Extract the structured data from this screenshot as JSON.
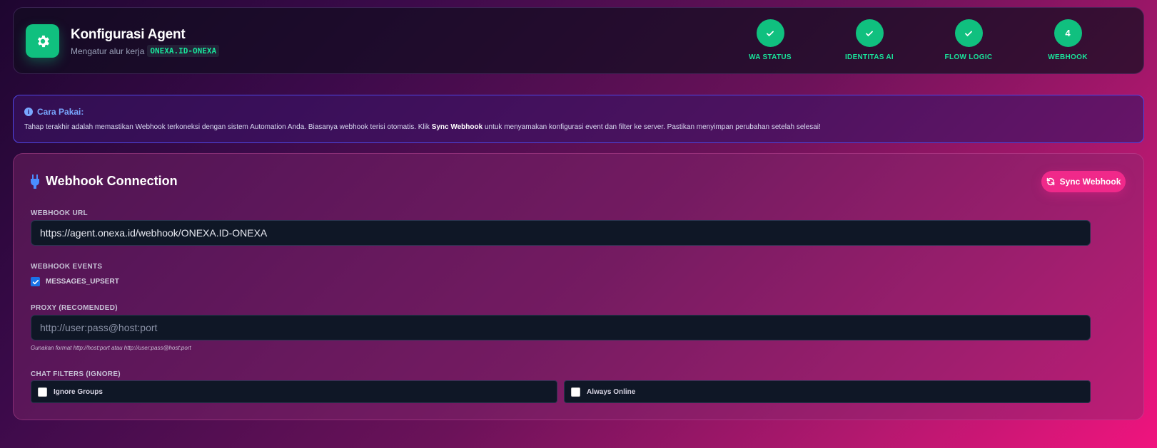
{
  "header": {
    "title": "Konfigurasi Agent",
    "subtitle_prefix": "Mengatur alur kerja",
    "instance_code": "ONEXA.ID-ONEXA",
    "logo_icon": "gear-icon",
    "accent_color": "#10c07f"
  },
  "steps": [
    {
      "label": "WA STATUS",
      "state": "done",
      "icon": "check-icon"
    },
    {
      "label": "IDENTITAS AI",
      "state": "done",
      "icon": "check-icon"
    },
    {
      "label": "FLOW LOGIC",
      "state": "done",
      "icon": "check-icon"
    },
    {
      "label": "WEBHOOK",
      "state": "current",
      "number": "4"
    }
  ],
  "info": {
    "title": "Cara Pakai:",
    "text_before": "Tahap terakhir adalah memastikan Webhook terkoneksi dengan sistem Automation Anda. Biasanya webhook terisi otomatis. Klik ",
    "text_bold": "Sync Webhook",
    "text_after": " untuk menyamakan konfigurasi event dan filter ke server. Pastikan menyimpan perubahan setelah selesai!",
    "border_color": "#4f46e5"
  },
  "webhook": {
    "section_title": "Webhook Connection",
    "section_icon": "plug-icon",
    "sync_label": "Sync Webhook",
    "sync_icon": "refresh-icon",
    "sync_color": "#f0298a",
    "url_label": "WEBHOOK URL",
    "url_value": "https://agent.onexa.id/webhook/ONEXA.ID-ONEXA",
    "events_label": "WEBHOOK EVENTS",
    "events": [
      {
        "label": "MESSAGES_UPSERT",
        "checked": true
      }
    ],
    "proxy_label": "PROXY (RECOMENDED)",
    "proxy_value": "",
    "proxy_placeholder": "http://user:pass@host:port",
    "proxy_hint": "Gunakan format http://host:port atau http://user:pass@host:port",
    "filters_label": "CHAT FILTERS (IGNORE)",
    "filters": [
      {
        "label": "Ignore Groups",
        "checked": false
      },
      {
        "label": "Always Online",
        "checked": false
      }
    ]
  }
}
